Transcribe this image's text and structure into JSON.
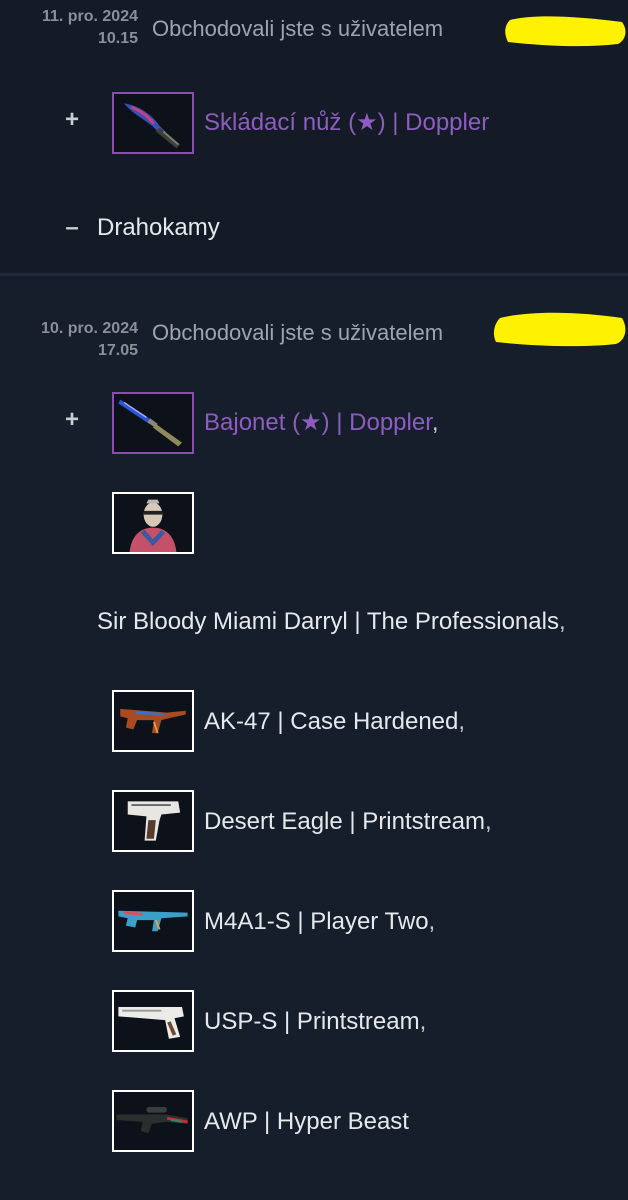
{
  "trades": [
    {
      "date": "11. pro. 2024",
      "time": "10.15",
      "description": "Obchodovali jste s uživatelem",
      "received_sign": "+",
      "received": [
        {
          "name": "Skládací nůž (★) | Doppler",
          "icon": "knife-doppler-image",
          "rarity_color": "#8650ac"
        }
      ],
      "given_sign": "–",
      "given_text": "Drahokamy"
    },
    {
      "date": "10. pro. 2024",
      "time": "17.05",
      "description": "Obchodovali jste s uživatelem",
      "received_sign": "+",
      "received": [
        {
          "name": "Bajonet (★) | Doppler",
          "suffix": ",",
          "icon": "bayonet-doppler-image",
          "rarity_color": "#8650ac"
        },
        {
          "name": "Sir Bloody Miami Darryl | The Professionals",
          "suffix": ",",
          "icon": "agent-image"
        },
        {
          "name": "AK-47 | Case Hardened",
          "suffix": ",",
          "icon": "ak47-image"
        },
        {
          "name": "Desert Eagle | Printstream",
          "suffix": ",",
          "icon": "desert-eagle-image"
        },
        {
          "name": "M4A1-S | Player Two",
          "suffix": ",",
          "icon": "m4a1s-image"
        },
        {
          "name": "USP-S | Printstream",
          "suffix": ",",
          "icon": "usps-image"
        },
        {
          "name": "AWP | Hyper Beast",
          "icon": "awp-image"
        }
      ]
    }
  ],
  "colors": {
    "background": "#141c2a",
    "purple_item": "#8650ac",
    "redaction": "#fff200"
  }
}
